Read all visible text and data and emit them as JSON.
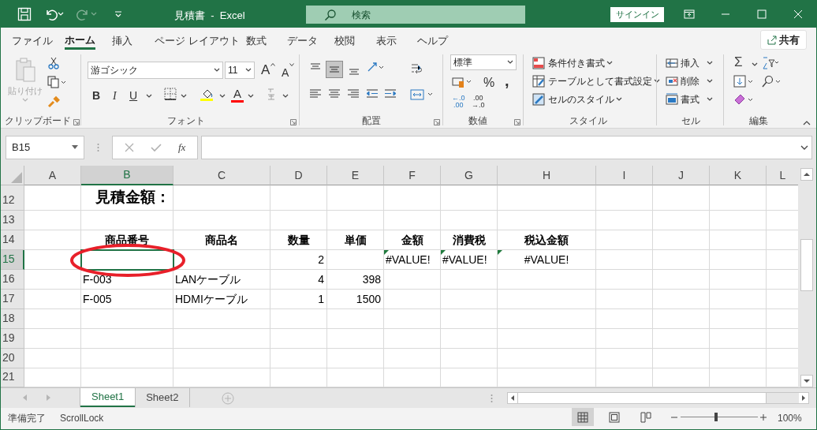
{
  "title_bar": {
    "title": "見積書  -  Excel",
    "search_placeholder": "検索",
    "sign_in": "サインイン"
  },
  "ribbon_tabs": [
    {
      "label": "ファイル",
      "selected": false
    },
    {
      "label": "ホーム",
      "selected": true
    },
    {
      "label": "挿入",
      "selected": false
    },
    {
      "label": "ページ レイアウト",
      "selected": false
    },
    {
      "label": "数式",
      "selected": false
    },
    {
      "label": "データ",
      "selected": false
    },
    {
      "label": "校閲",
      "selected": false
    },
    {
      "label": "表示",
      "selected": false
    },
    {
      "label": "ヘルプ",
      "selected": false
    }
  ],
  "share_button": "共有",
  "ribbon": {
    "clipboard": {
      "label": "クリップボード",
      "paste": "貼り付け",
      "paste_disabled": true
    },
    "font": {
      "label": "フォント",
      "font_name": "游ゴシック",
      "font_size": "11",
      "grow": "A",
      "shrink": "A",
      "bold": "B",
      "italic": "I",
      "underline": "U",
      "font_color_letter": "A"
    },
    "alignment": {
      "label": "配置",
      "middle_align_selected": true
    },
    "number": {
      "label": "数値",
      "format": "標準",
      "percent": "%",
      "comma": ",",
      "increase_decimal": [
        "←.0",
        ".00"
      ],
      "decrease_decimal": [
        ".00",
        "→.0"
      ]
    },
    "styles": {
      "label": "スタイル",
      "items": [
        "条件付き書式",
        "テーブルとして書式設定",
        "セルのスタイル"
      ]
    },
    "cells": {
      "label": "セル",
      "items": [
        "挿入",
        "削除",
        "書式"
      ]
    },
    "editing": {
      "label": "編集",
      "sum": "Σ"
    }
  },
  "name_box": "B15",
  "function_label": "fx",
  "columns": [
    {
      "label": "A",
      "selected": false
    },
    {
      "label": "B",
      "selected": true
    },
    {
      "label": "C",
      "selected": false
    },
    {
      "label": "D",
      "selected": false
    },
    {
      "label": "E",
      "selected": false
    },
    {
      "label": "F",
      "selected": false
    },
    {
      "label": "G",
      "selected": false
    },
    {
      "label": "H",
      "selected": false
    },
    {
      "label": "I",
      "selected": false
    },
    {
      "label": "J",
      "selected": false
    },
    {
      "label": "K",
      "selected": false
    },
    {
      "label": "L",
      "selected": false
    }
  ],
  "rows": [
    {
      "number": "12",
      "selected": false,
      "kind": "tall",
      "cells": [
        {},
        {
          "text": "見積金額：",
          "kind": "title"
        },
        {},
        {},
        {},
        {},
        {},
        {},
        {},
        {},
        {},
        {}
      ]
    },
    {
      "number": "13",
      "selected": false,
      "cells": [
        {},
        {},
        {},
        {},
        {},
        {},
        {},
        {},
        {},
        {},
        {},
        {}
      ]
    },
    {
      "number": "14",
      "selected": false,
      "cells": [
        {},
        {
          "text": "商品番号",
          "kind": "header"
        },
        {
          "text": "商品名",
          "kind": "header"
        },
        {
          "text": "数量",
          "kind": "header"
        },
        {
          "text": "単価",
          "kind": "header"
        },
        {
          "text": "金額",
          "kind": "header"
        },
        {
          "text": "消費税",
          "kind": "header"
        },
        {
          "text": "税込金額",
          "kind": "header"
        },
        {},
        {},
        {},
        {}
      ]
    },
    {
      "number": "15",
      "selected": true,
      "cells": [
        {},
        {
          "active": true
        },
        {},
        {
          "text": "2",
          "kind": "number"
        },
        {},
        {
          "text": "#VALUE!",
          "kind": "error",
          "error_flag": true
        },
        {
          "text": "#VALUE!",
          "kind": "error",
          "error_flag": true
        },
        {
          "text": "#VALUE!",
          "kind": "centered",
          "error_flag": true
        },
        {},
        {},
        {},
        {}
      ]
    },
    {
      "number": "16",
      "selected": false,
      "cells": [
        {},
        {
          "text": "F-003",
          "kind": "text"
        },
        {
          "text": "LANケーブル",
          "kind": "text"
        },
        {
          "text": "4",
          "kind": "number"
        },
        {
          "text": "398",
          "kind": "number"
        },
        {},
        {},
        {},
        {},
        {},
        {},
        {}
      ]
    },
    {
      "number": "17",
      "selected": false,
      "cells": [
        {},
        {
          "text": "F-005",
          "kind": "text"
        },
        {
          "text": "HDMIケーブル",
          "kind": "text"
        },
        {
          "text": "1",
          "kind": "number"
        },
        {
          "text": "1500",
          "kind": "number"
        },
        {},
        {},
        {},
        {},
        {},
        {},
        {}
      ]
    },
    {
      "number": "18",
      "selected": false,
      "cells": [
        {},
        {},
        {},
        {},
        {},
        {},
        {},
        {},
        {},
        {},
        {},
        {}
      ]
    },
    {
      "number": "19",
      "selected": false,
      "cells": [
        {},
        {},
        {},
        {},
        {},
        {},
        {},
        {},
        {},
        {},
        {},
        {}
      ]
    },
    {
      "number": "20",
      "selected": false,
      "cells": [
        {},
        {},
        {},
        {},
        {},
        {},
        {},
        {},
        {},
        {},
        {},
        {}
      ]
    },
    {
      "number": "21",
      "selected": false,
      "kind": "cut",
      "cells": [
        {},
        {},
        {},
        {},
        {},
        {},
        {},
        {},
        {},
        {},
        {},
        {}
      ]
    }
  ],
  "annotation": {
    "kind": "ellipse",
    "color": "#e8202a"
  },
  "sheet_tabs": [
    {
      "label": "Sheet1",
      "selected": true
    },
    {
      "label": "Sheet2",
      "selected": false
    }
  ],
  "status_bar": {
    "ready": "準備完了",
    "scroll_lock": "ScrollLock",
    "views": [
      {
        "selected": true
      },
      {
        "selected": false
      },
      {
        "selected": false
      }
    ],
    "zoom": {
      "level": 0.46,
      "reading": "100%"
    }
  }
}
